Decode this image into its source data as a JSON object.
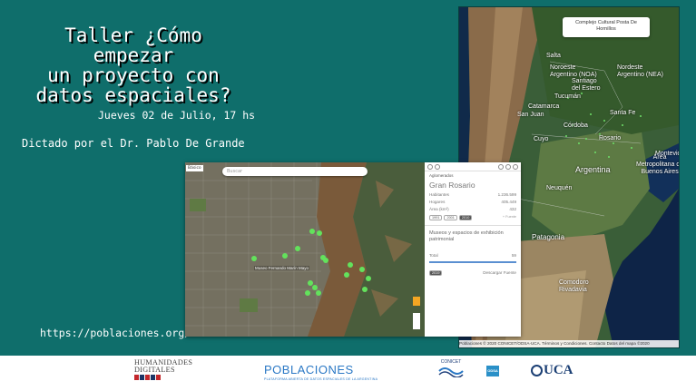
{
  "slide": {
    "title": "Taller ¿Cómo empezar\nun proyecto con\ndatos espaciales?",
    "date": "Jueves 02 de Julio, 17 hs",
    "speaker": "Dictado por el Dr. Pablo De Grande",
    "url": "https://poblaciones.org/"
  },
  "big_map": {
    "tooltip_line1": "Complejo Cultural Posta De",
    "tooltip_line2": "Hornillos",
    "labels": {
      "salta": "Salta",
      "santiago": "Santiago\ndel Estero",
      "noa": "Noroeste\nArgentino (NOA)",
      "nea": "Nordeste\nArgentino (NEA)",
      "tucuman": "Tucumán",
      "catamarca": "Catamarca",
      "sanjuan": "San Juan",
      "santafe": "Santa Fe",
      "cuyo": "Cuyo",
      "cordoba": "Córdoba",
      "rosario": "Rosario",
      "argentina": "Argentina",
      "area": "Área\nMetropolitana de\nBuenos Aires",
      "montevideo": "Montevideo",
      "neuquen": "Neuquén",
      "patagonia": "Patagonia",
      "comodoro": "Comodoro\nRivadavia"
    },
    "attribution": "Poblaciones © 2020 CONICET/ODSA-UCA. Términos y Condiciones.  Contacto   Datos del mapa ©2020"
  },
  "inset": {
    "map_title": "Básico",
    "search_placeholder": "Buscar",
    "marker_label": "Museo Fernando Marín Mayo",
    "panel": {
      "section": "Aglomerados",
      "name": "Gran Rosario",
      "rows": [
        {
          "label": "Habitantes",
          "value": "1.236.599"
        },
        {
          "label": "Hogares",
          "value": "405.449"
        },
        {
          "label": "Área (km²)",
          "value": "432"
        }
      ],
      "tabs": [
        "1991",
        "2001",
        "2010"
      ],
      "tabs_right": "+ Fuente",
      "museum_title": "Museos y espacios de exhibición patrimonial",
      "total_label": "Total",
      "total_value": "59",
      "year_tag": "2019",
      "footer_left": "Descargar",
      "footer_right": "Fuente"
    }
  },
  "footer": {
    "hd_line1": "HUMANIDADES",
    "hd_line2": "DIGITALES",
    "hd_lab": "L A B",
    "poblaciones": "POBLACIONES",
    "poblaciones_sub": "PLATAFORMA ABIERTA DE DATOS ESPACIALES DE LA ARGENTINA",
    "conicet": "CONICET",
    "odsa": "ODSA",
    "uca": "UCA"
  }
}
